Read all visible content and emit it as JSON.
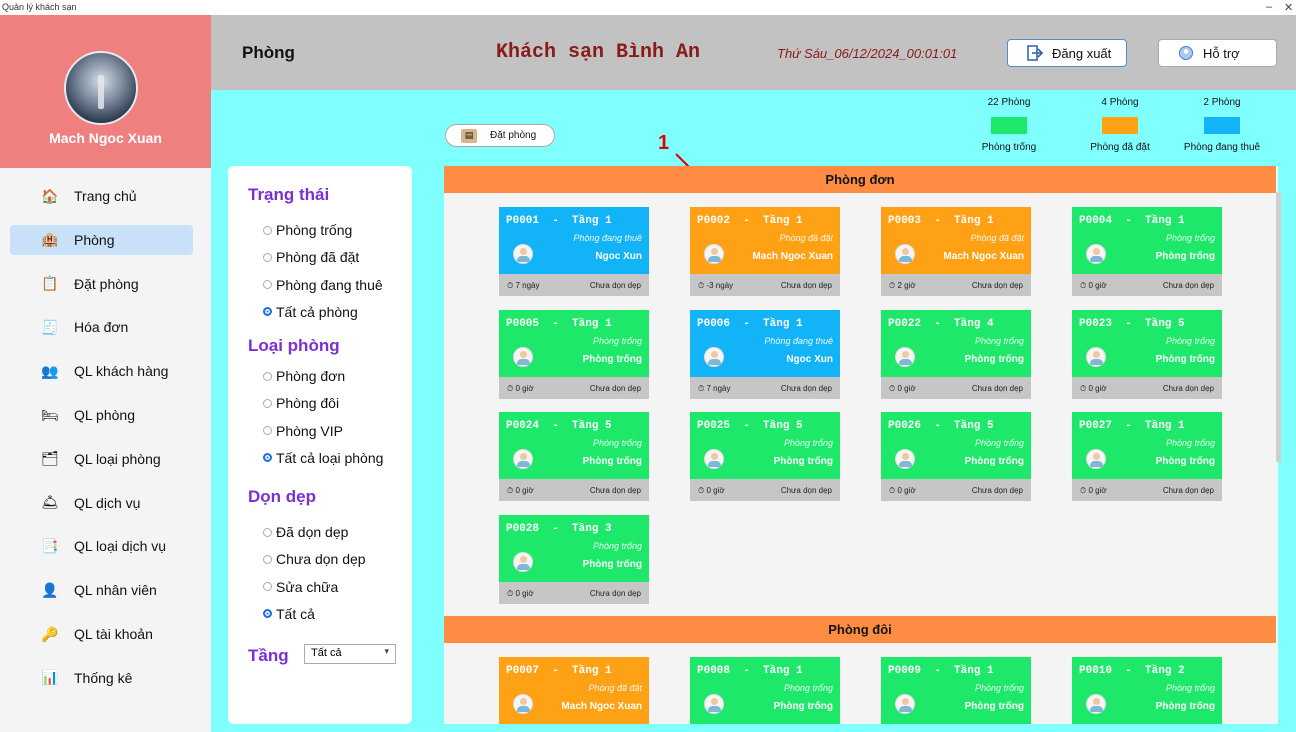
{
  "window": {
    "title": "Quản lý khách sạn",
    "minimize": "–",
    "close": "✕"
  },
  "profile": {
    "name": "Mach Ngoc Xuan"
  },
  "nav": [
    {
      "label": "Trang chủ",
      "icon": "home-icon",
      "glyph": "🏠",
      "active": false
    },
    {
      "label": "Phòng",
      "icon": "room-icon",
      "glyph": "🏨",
      "active": true
    },
    {
      "label": "Đặt phòng",
      "icon": "booking-icon",
      "glyph": "📋",
      "active": false
    },
    {
      "label": "Hóa đơn",
      "icon": "invoice-icon",
      "glyph": "🧾",
      "active": false
    },
    {
      "label": "QL khách hàng",
      "icon": "customers-icon",
      "glyph": "👥",
      "active": false
    },
    {
      "label": "QL phòng",
      "icon": "manage-rooms-icon",
      "glyph": "🛏",
      "active": false
    },
    {
      "label": "QL loại phòng",
      "icon": "room-types-icon",
      "glyph": "🗂",
      "active": false
    },
    {
      "label": "QL dịch vụ",
      "icon": "services-icon",
      "glyph": "🛎",
      "active": false
    },
    {
      "label": "QL loại dịch vụ",
      "icon": "service-types-icon",
      "glyph": "📑",
      "active": false
    },
    {
      "label": "QL nhân viên",
      "icon": "staff-icon",
      "glyph": "👤",
      "active": false
    },
    {
      "label": "QL tài khoản",
      "icon": "accounts-icon",
      "glyph": "🔑",
      "active": false
    },
    {
      "label": "Thống kê",
      "icon": "statistics-icon",
      "glyph": "📊",
      "active": false
    }
  ],
  "header": {
    "title": "Phòng",
    "hotel": "Khách sạn Bình An",
    "datetime": "Thứ Sáu_06/12/2024_00:01:01",
    "logout": "Đăng xuất",
    "help": "Hỗ trợ"
  },
  "book_button": "Đặt phòng",
  "legend": [
    {
      "count": "22 Phòng",
      "label": "Phòng trống",
      "color": "#1ee86a"
    },
    {
      "count": "4 Phòng",
      "label": "Phòng đã đặt",
      "color": "#ffa114"
    },
    {
      "count": "2 Phòng",
      "label": "Phòng đang thuê",
      "color": "#13b4f7"
    }
  ],
  "annotation": "1",
  "filters": {
    "status_title": "Trạng thái",
    "status_options": [
      {
        "label": "Phòng trống",
        "selected": false
      },
      {
        "label": "Phòng đã đặt",
        "selected": false
      },
      {
        "label": "Phòng đang thuê",
        "selected": false
      },
      {
        "label": "Tất cả phòng",
        "selected": true
      }
    ],
    "type_title": "Loại phòng",
    "type_options": [
      {
        "label": "Phòng đơn",
        "selected": false
      },
      {
        "label": "Phòng đôi",
        "selected": false
      },
      {
        "label": "Phòng VIP",
        "selected": false
      },
      {
        "label": "Tất cả loại phòng",
        "selected": true
      }
    ],
    "clean_title": "Dọn dẹp",
    "clean_options": [
      {
        "label": "Đã dọn dẹp",
        "selected": false
      },
      {
        "label": "Chưa dọn dẹp",
        "selected": false
      },
      {
        "label": "Sửa chữa",
        "selected": false
      },
      {
        "label": "Tất cả",
        "selected": true
      }
    ],
    "floor_label": "Tầng",
    "floor_value": "Tất cả"
  },
  "sections": [
    {
      "title": "Phòng đơn",
      "rooms": [
        {
          "code": "P0001",
          "floor": "Tầng 1",
          "status": "Phòng đang thuê",
          "guest": "Ngoc Xun",
          "duration": "7 ngày",
          "clean": "Chưa dọn dẹp",
          "kind": "rented"
        },
        {
          "code": "P0002",
          "floor": "Tầng 1",
          "status": "Phòng đã đặt",
          "guest": "Mach Ngoc Xuan",
          "duration": "-3 ngày",
          "clean": "Chưa dọn dẹp",
          "kind": "booked"
        },
        {
          "code": "P0003",
          "floor": "Tầng 1",
          "status": "Phòng đã đặt",
          "guest": "Mach Ngoc Xuan",
          "duration": "2 giờ",
          "clean": "Chưa dọn dẹp",
          "kind": "booked"
        },
        {
          "code": "P0004",
          "floor": "Tầng 1",
          "status": "Phòng trống",
          "guest": "Phòng trống",
          "duration": "0 giờ",
          "clean": "Chưa dọn dẹp",
          "kind": "empty"
        },
        {
          "code": "P0005",
          "floor": "Tầng 1",
          "status": "Phòng trống",
          "guest": "Phòng trống",
          "duration": "0 giờ",
          "clean": "Chưa dọn dẹp",
          "kind": "empty"
        },
        {
          "code": "P0006",
          "floor": "Tầng 1",
          "status": "Phòng đang thuê",
          "guest": "Ngoc Xun",
          "duration": "7 ngày",
          "clean": "Chưa dọn dẹp",
          "kind": "rented"
        },
        {
          "code": "P0022",
          "floor": "Tầng 4",
          "status": "Phòng trống",
          "guest": "Phòng trống",
          "duration": "0 giờ",
          "clean": "Chưa dọn dẹp",
          "kind": "empty"
        },
        {
          "code": "P0023",
          "floor": "Tầng 5",
          "status": "Phòng trống",
          "guest": "Phòng trống",
          "duration": "0 giờ",
          "clean": "Chưa dọn dẹp",
          "kind": "empty"
        },
        {
          "code": "P0024",
          "floor": "Tầng 5",
          "status": "Phòng trống",
          "guest": "Phòng trống",
          "duration": "0 giờ",
          "clean": "Chưa dọn dẹp",
          "kind": "empty"
        },
        {
          "code": "P0025",
          "floor": "Tầng 5",
          "status": "Phòng trống",
          "guest": "Phòng trống",
          "duration": "0 giờ",
          "clean": "Chưa dọn dẹp",
          "kind": "empty"
        },
        {
          "code": "P0026",
          "floor": "Tầng 5",
          "status": "Phòng trống",
          "guest": "Phòng trống",
          "duration": "0 giờ",
          "clean": "Chưa dọn dẹp",
          "kind": "empty"
        },
        {
          "code": "P0027",
          "floor": "Tầng 1",
          "status": "Phòng trống",
          "guest": "Phòng trống",
          "duration": "0 giờ",
          "clean": "Chưa dọn dẹp",
          "kind": "empty"
        },
        {
          "code": "P0028",
          "floor": "Tầng 3",
          "status": "Phòng trống",
          "guest": "Phòng trống",
          "duration": "0 giờ",
          "clean": "Chưa dọn dẹp",
          "kind": "empty"
        }
      ]
    },
    {
      "title": "Phòng đôi",
      "rooms": [
        {
          "code": "P0007",
          "floor": "Tầng 1",
          "status": "Phòng đã đặt",
          "guest": "Mach Ngoc Xuan",
          "duration": "",
          "clean": "",
          "kind": "booked"
        },
        {
          "code": "P0008",
          "floor": "Tầng 1",
          "status": "Phòng trống",
          "guest": "Phòng trống",
          "duration": "",
          "clean": "",
          "kind": "empty"
        },
        {
          "code": "P0009",
          "floor": "Tầng 1",
          "status": "Phòng trống",
          "guest": "Phòng trống",
          "duration": "",
          "clean": "",
          "kind": "empty"
        },
        {
          "code": "P0010",
          "floor": "Tầng 2",
          "status": "Phòng trống",
          "guest": "Phòng trống",
          "duration": "",
          "clean": "",
          "kind": "empty"
        }
      ]
    }
  ]
}
